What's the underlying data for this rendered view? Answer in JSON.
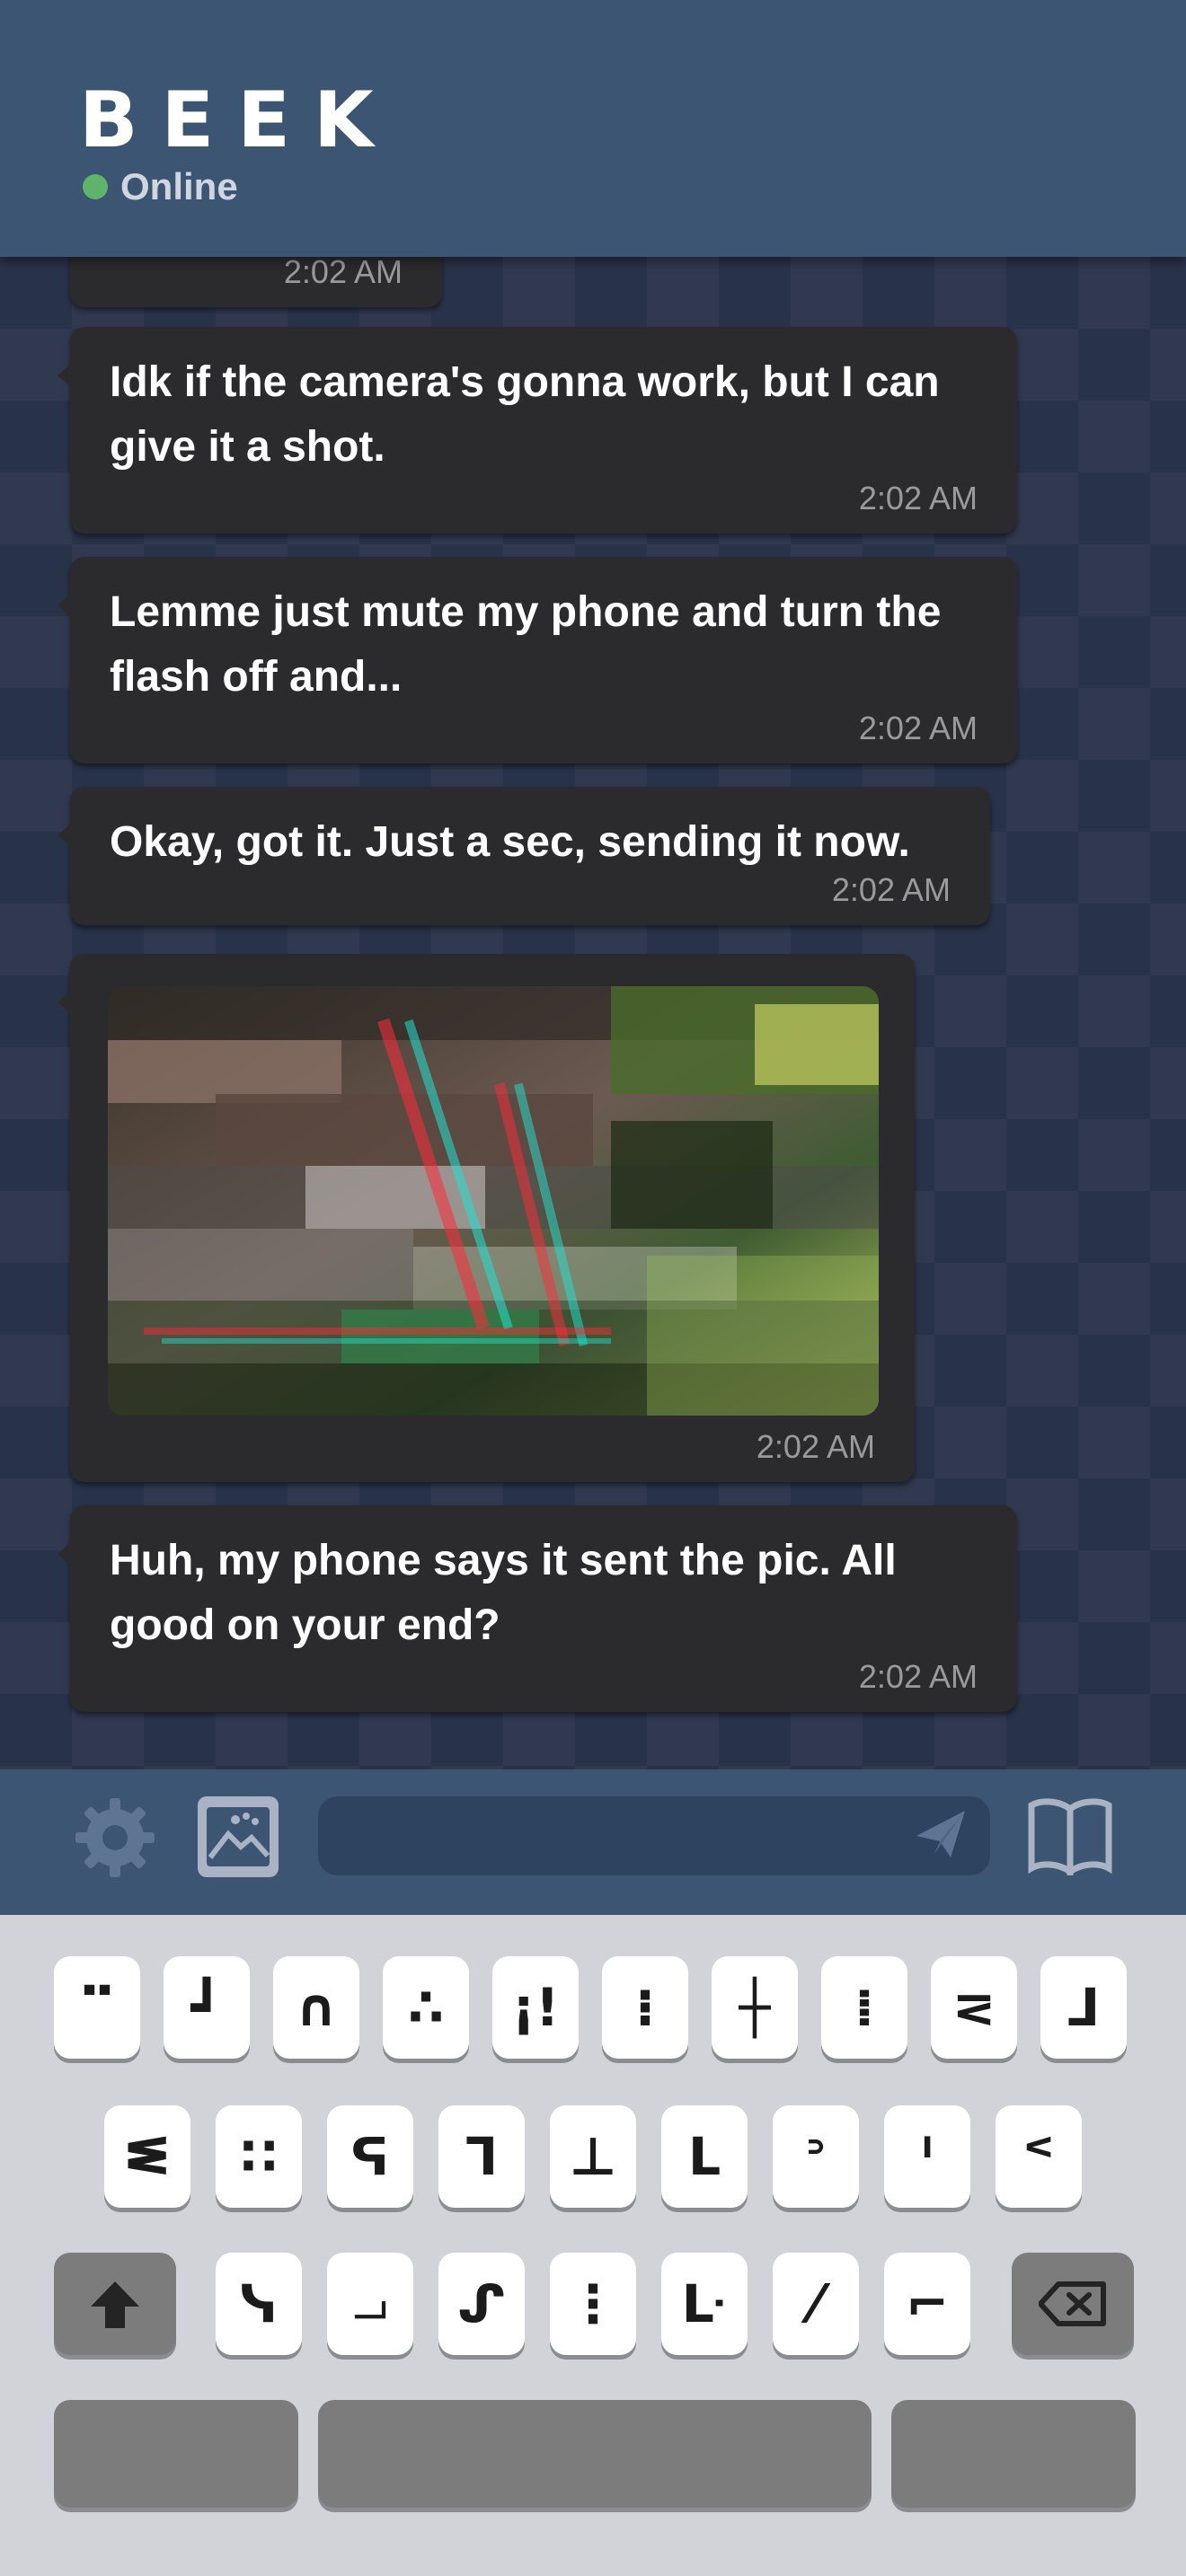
{
  "header": {
    "title": "BEEK",
    "status": "Online",
    "status_color": "#5fb36a"
  },
  "messages": [
    {
      "text": "",
      "time": "2:02 AM"
    },
    {
      "text": "Idk if the camera's gonna work, but I can give it a shot.",
      "time": "2:02 AM"
    },
    {
      "text": "Lemme just mute my phone and turn the flash off and...",
      "time": "2:02 AM"
    },
    {
      "text": "Okay, got it. Just a sec, sending it now.",
      "time": "2:02 AM"
    },
    {
      "image": "glitched-photo",
      "time": "2:02 AM"
    },
    {
      "text": "Huh, my phone says it sent the pic. All good on your end?",
      "time": "2:02 AM"
    }
  ],
  "input_bar": {
    "icons": [
      "gear-icon",
      "image-icon",
      "send-icon",
      "book-icon"
    ],
    "message_value": ""
  },
  "keyboard": {
    "row1": [
      "⠉",
      "┛",
      "∩",
      "∴",
      "¡!",
      "⁝",
      "┼",
      "⁞",
      "⋜",
      "ᒧ"
    ],
    "row2": [
      "ᓬ",
      "∷",
      "ᕋ",
      "ᒣ",
      "⊥",
      "ᒪ",
      "ᐣ",
      "ᑊ",
      "ᑉ"
    ],
    "row3": [
      "ᓭ",
      "⏗",
      "ᔑ",
      "⋮",
      "ᒷ",
      "⁄",
      "⌐"
    ],
    "shift_icon": "shift-arrow-icon",
    "backspace_icon": "backspace-icon"
  }
}
